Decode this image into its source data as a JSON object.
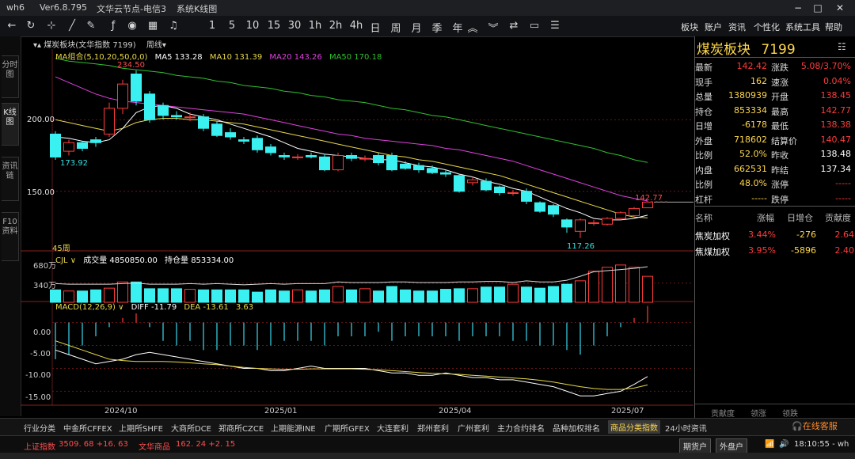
{
  "titlebar": {
    "app": "wh6",
    "version": "Ver6.8.795",
    "server": "文华云节点-电信3",
    "mode": "系统K线图"
  },
  "toolbar": {
    "periods": [
      "1",
      "5",
      "10",
      "15",
      "30",
      "1h",
      "2h",
      "4h",
      "日",
      "周",
      "月",
      "季",
      "年"
    ],
    "menus": [
      "板块",
      "账户",
      "资讯",
      "个性化",
      "系统工具",
      "帮助"
    ]
  },
  "side_tabs": [
    "分时图",
    "K线图",
    "资讯链",
    "F10资料"
  ],
  "chart_header": {
    "name": "煤炭板块(文华指数 7199)",
    "period": "周线"
  },
  "ma_legend": {
    "label": "MA组合(5,10,20,50,0,0)",
    "ma5": "MA5 133.28",
    "ma10": "MA10 131.39",
    "ma20": "MA20 143.26",
    "ma50": "MA50 170.18"
  },
  "ma_colors": {
    "ma5": "#ffffff",
    "ma10": "#e8d84a",
    "ma20": "#e040e0",
    "ma50": "#30c030"
  },
  "price_axis": {
    "l200": "200.00",
    "l150": "150.00"
  },
  "annotations": {
    "high": "234.50",
    "left_low": "173.92",
    "low": "117.26",
    "last": "142.77",
    "bars": "45周"
  },
  "volume_header": {
    "label": "CJL",
    "vol": "成交量 4850850.00",
    "oi": "持仓量 853334.00",
    "axis_top": "680万",
    "axis_mid": "340万"
  },
  "macd_header": {
    "label": "MACD(12,26,9)",
    "diff": "DIFF -11.79",
    "dea": "DEA -13.61",
    "macd": "3.63",
    "a0": "0.00",
    "a1": "-5.00",
    "a2": "-10.00",
    "a3": "-15.00"
  },
  "x_labels": [
    "2024/10",
    "2025/01",
    "2025/04",
    "2025/07"
  ],
  "quote": {
    "title": "煤炭板块",
    "code": "7199",
    "rows": [
      {
        "l1": "最新",
        "v1": "142.42",
        "c1": "red",
        "l2": "涨跌",
        "v2": "5.08/3.70%",
        "c2": "red"
      },
      {
        "l1": "现手",
        "v1": "162",
        "c1": "yellow",
        "l2": "速涨",
        "v2": "0.04%",
        "c2": "red"
      },
      {
        "l1": "总量",
        "v1": "1380939",
        "c1": "yellow",
        "l2": "开盘",
        "v2": "138.45",
        "c2": "red"
      },
      {
        "l1": "持仓",
        "v1": "853334",
        "c1": "yellow",
        "l2": "最高",
        "v2": "142.77",
        "c2": "red"
      },
      {
        "l1": "日增",
        "v1": "-6178",
        "c1": "yellow",
        "l2": "最低",
        "v2": "138.38",
        "c2": "red"
      },
      {
        "l1": "外盘",
        "v1": "718602",
        "c1": "yellow",
        "l2": "结算价",
        "v2": "140.47",
        "c2": "red"
      },
      {
        "l1": "比例",
        "v1": "52.0%",
        "c1": "yellow",
        "l2": "昨收",
        "v2": "138.48",
        "c2": "white"
      },
      {
        "l1": "内盘",
        "v1": "662531",
        "c1": "yellow",
        "l2": "昨结",
        "v2": "137.34",
        "c2": "white"
      },
      {
        "l1": "比例",
        "v1": "48.0%",
        "c1": "yellow",
        "l2": "涨停",
        "v2": "-----",
        "c2": "red"
      },
      {
        "l1": "杠杆",
        "v1": "-----",
        "c1": "yellow",
        "l2": "跌停",
        "v2": "-----",
        "c2": "red"
      }
    ],
    "component_headers": [
      "名称",
      "涨幅",
      "日增仓",
      "贡献度"
    ],
    "components": [
      {
        "name": "焦炭加权",
        "chg": "3.44%",
        "oi": "-276",
        "contrib": "2.64"
      },
      {
        "name": "焦煤加权",
        "chg": "3.95%",
        "oi": "-5896",
        "contrib": "2.40"
      }
    ],
    "bottom_tabs": [
      "贡献度",
      "领涨",
      "领跌"
    ]
  },
  "bottom_tabs": [
    "行业分类",
    "中金所CFFEX",
    "上期所SHFE",
    "大商所DCE",
    "郑商所CZCE",
    "上期能源INE",
    "广期所GFEX",
    "大连套利",
    "郑州套利",
    "广州套利",
    "主力合约排名",
    "品种加权排名",
    "商品分类指数",
    "24小时资讯"
  ],
  "status": {
    "sh_label": "上证指数",
    "sh_val": "3509. 68 +16. 63",
    "wh_label": "文华商品",
    "wh_val": "162. 24 +2. 15",
    "btn1": "期货户",
    "btn2": "外盘户",
    "service": "在线客服",
    "time": "18:10:55 - wh"
  },
  "chart_data": {
    "type": "candlestick",
    "title": "煤炭板块(文华指数 7199)",
    "period": "weekly",
    "x_ticks": [
      "2024/10",
      "2025/01",
      "2025/04",
      "2025/07"
    ],
    "ylim": [
      110,
      245
    ],
    "candles": [
      {
        "o": 190,
        "c": 173.92,
        "h": 192,
        "l": 172
      },
      {
        "o": 178,
        "c": 184,
        "h": 186,
        "l": 175
      },
      {
        "o": 184,
        "c": 180,
        "h": 185,
        "l": 178
      },
      {
        "o": 186,
        "c": 184,
        "h": 188,
        "l": 181
      },
      {
        "o": 190,
        "c": 208,
        "h": 212,
        "l": 188
      },
      {
        "o": 208,
        "c": 225,
        "h": 228,
        "l": 204
      },
      {
        "o": 232,
        "c": 213,
        "h": 234.5,
        "l": 210
      },
      {
        "o": 218,
        "c": 200,
        "h": 220,
        "l": 198
      },
      {
        "o": 210,
        "c": 203,
        "h": 212,
        "l": 200
      },
      {
        "o": 203,
        "c": 202,
        "h": 206,
        "l": 200
      },
      {
        "o": 202,
        "c": 202,
        "h": 205,
        "l": 199
      },
      {
        "o": 202,
        "c": 194,
        "h": 204,
        "l": 192
      },
      {
        "o": 197,
        "c": 189,
        "h": 199,
        "l": 188
      },
      {
        "o": 191,
        "c": 188,
        "h": 194,
        "l": 186
      },
      {
        "o": 186,
        "c": 185,
        "h": 188,
        "l": 183
      },
      {
        "o": 187,
        "c": 179,
        "h": 189,
        "l": 177
      },
      {
        "o": 181,
        "c": 177,
        "h": 183,
        "l": 175
      },
      {
        "o": 175,
        "c": 174,
        "h": 177,
        "l": 172
      },
      {
        "o": 174,
        "c": 174,
        "h": 176,
        "l": 172
      },
      {
        "o": 175,
        "c": 174,
        "h": 177,
        "l": 173
      },
      {
        "o": 174,
        "c": 165,
        "h": 176,
        "l": 164
      },
      {
        "o": 165,
        "c": 175,
        "h": 177,
        "l": 164
      },
      {
        "o": 175,
        "c": 173,
        "h": 177,
        "l": 171
      },
      {
        "o": 173,
        "c": 173,
        "h": 175,
        "l": 171
      },
      {
        "o": 175,
        "c": 170,
        "h": 177,
        "l": 168
      },
      {
        "o": 175,
        "c": 165,
        "h": 177,
        "l": 164
      },
      {
        "o": 169,
        "c": 166,
        "h": 171,
        "l": 165
      },
      {
        "o": 168,
        "c": 165,
        "h": 170,
        "l": 163
      },
      {
        "o": 166,
        "c": 163,
        "h": 168,
        "l": 162
      },
      {
        "o": 163,
        "c": 162,
        "h": 165,
        "l": 160
      },
      {
        "o": 161,
        "c": 150,
        "h": 162,
        "l": 149
      },
      {
        "o": 156,
        "c": 158,
        "h": 160,
        "l": 154
      },
      {
        "o": 157,
        "c": 151,
        "h": 159,
        "l": 150
      },
      {
        "o": 153,
        "c": 149,
        "h": 154,
        "l": 147
      },
      {
        "o": 149,
        "c": 149,
        "h": 151,
        "l": 147
      },
      {
        "o": 150,
        "c": 143,
        "h": 152,
        "l": 141
      },
      {
        "o": 142,
        "c": 136,
        "h": 143,
        "l": 135
      },
      {
        "o": 140,
        "c": 134,
        "h": 141,
        "l": 132
      },
      {
        "o": 130,
        "c": 125,
        "h": 131,
        "l": 121
      },
      {
        "o": 122,
        "c": 130,
        "h": 131,
        "l": 117.26
      },
      {
        "o": 128,
        "c": 128,
        "h": 130,
        "l": 126
      },
      {
        "o": 127,
        "c": 131,
        "h": 132,
        "l": 126
      },
      {
        "o": 131,
        "c": 135,
        "h": 136,
        "l": 130
      },
      {
        "o": 133,
        "c": 138,
        "h": 139,
        "l": 132
      },
      {
        "o": 138.45,
        "c": 142.42,
        "h": 142.77,
        "l": 138.38
      }
    ],
    "volume": [
      2.2,
      2.0,
      2.0,
      2.2,
      2.5,
      3.6,
      3.6,
      2.4,
      2.4,
      2.4,
      2.3,
      2.2,
      2.2,
      2.2,
      2.2,
      1.8,
      2.2,
      2.0,
      2.2,
      2.0,
      2.2,
      2.8,
      2.2,
      2.4,
      2.0,
      2.8,
      2.2,
      2.0,
      2.0,
      2.3,
      2.4,
      2.4,
      2.7,
      2.7,
      3.2,
      2.7,
      2.5,
      2.8,
      3.2,
      3.8,
      5.5,
      6.2,
      6.6,
      6.2,
      4.6
    ],
    "open_interest": [
      3.3,
      3.2,
      3.2,
      3.2,
      3.2,
      3.3,
      3.4,
      3.2,
      3.2,
      3.2,
      3.3,
      3.2,
      3.3,
      3.2,
      3.1,
      3.2,
      3.3,
      3.2,
      3.3,
      3.3,
      3.3,
      3.6,
      3.5,
      3.5,
      3.5,
      3.6,
      3.6,
      3.5,
      3.5,
      3.5,
      3.6,
      3.6,
      3.7,
      3.7,
      3.5,
      3.8,
      3.6,
      3.6,
      3.9,
      4.6,
      5.4,
      5.6,
      5.8,
      6.0,
      6.3
    ],
    "volume_unit": "万",
    "macd": [
      -8,
      -7,
      -5,
      -3,
      -1,
      1,
      2,
      -1,
      -4,
      -5,
      -4,
      -6,
      -6,
      -5,
      -5,
      -6,
      -5,
      -4,
      -4,
      -4,
      -5,
      -3,
      -3,
      -3,
      -2,
      -4,
      -3,
      -3,
      -3,
      -3,
      -4,
      -3,
      -3,
      -3,
      -4,
      -4,
      -5,
      -5,
      -6,
      -7,
      -5,
      -3,
      -1,
      1,
      3.63
    ],
    "diff": [
      -6,
      -7,
      -8,
      -9,
      -8.5,
      -8,
      -7,
      -6.5,
      -7,
      -7.5,
      -8,
      -8.5,
      -9,
      -9.5,
      -10,
      -10,
      -10.5,
      -10.5,
      -10,
      -9.5,
      -10,
      -10,
      -10,
      -10,
      -10.5,
      -11,
      -11,
      -11.5,
      -11.5,
      -11,
      -11.5,
      -12,
      -12,
      -12.5,
      -12.5,
      -13,
      -13.5,
      -14,
      -15,
      -16,
      -16,
      -15.5,
      -15,
      -13.5,
      -11.79
    ],
    "dea": [
      -4,
      -5,
      -6,
      -7,
      -8,
      -8.3,
      -8.5,
      -8.5,
      -8.5,
      -8.6,
      -8.8,
      -9,
      -9.2,
      -9.5,
      -9.8,
      -10,
      -10.1,
      -10.2,
      -10.2,
      -10.1,
      -10.1,
      -10.1,
      -10.1,
      -10.2,
      -10.3,
      -10.5,
      -10.7,
      -10.9,
      -11.1,
      -11.2,
      -11.3,
      -11.5,
      -11.7,
      -11.9,
      -12.1,
      -12.3,
      -12.6,
      -13,
      -13.5,
      -14,
      -14.4,
      -14.6,
      -14.6,
      -14.3,
      -13.61
    ],
    "ma5": [
      188,
      187,
      185,
      184,
      186,
      194,
      205,
      209,
      210,
      208,
      204,
      202,
      200,
      197,
      194,
      191,
      188,
      184,
      180,
      178,
      176,
      175,
      174,
      173,
      172,
      172,
      170,
      168,
      167,
      165,
      162,
      160,
      157,
      155,
      152,
      150,
      146,
      142,
      138,
      135,
      131,
      130,
      130,
      131,
      133.28
    ],
    "ma10": [
      200,
      198,
      196,
      194,
      192,
      194,
      198,
      200,
      201,
      201,
      200,
      200,
      199,
      198,
      197,
      195,
      193,
      191,
      189,
      187,
      185,
      183,
      181,
      179,
      177,
      175,
      174,
      172,
      171,
      169,
      167,
      165,
      163,
      161,
      158,
      155,
      152,
      149,
      146,
      143,
      140,
      137,
      134,
      132,
      131.39
    ],
    "ma20": [
      230,
      226,
      222,
      218,
      215,
      213,
      212,
      211,
      210,
      209,
      208,
      207,
      206,
      205,
      204,
      202,
      200,
      198,
      196,
      194,
      192,
      190,
      189,
      187,
      186,
      185,
      184,
      183,
      182,
      180,
      179,
      177,
      175,
      173,
      171,
      168,
      165,
      162,
      159,
      156,
      153,
      150,
      147,
      145,
      143.26
    ],
    "ma50": [
      243,
      241,
      240,
      239,
      238,
      236,
      235,
      234,
      233,
      231,
      230,
      229,
      227,
      226,
      224,
      223,
      222,
      220,
      219,
      217,
      216,
      214,
      213,
      212,
      210,
      208,
      207,
      205,
      203,
      202,
      200,
      198,
      196,
      194,
      192,
      190,
      188,
      186,
      184,
      182,
      180,
      177,
      175,
      172,
      170.18
    ]
  }
}
